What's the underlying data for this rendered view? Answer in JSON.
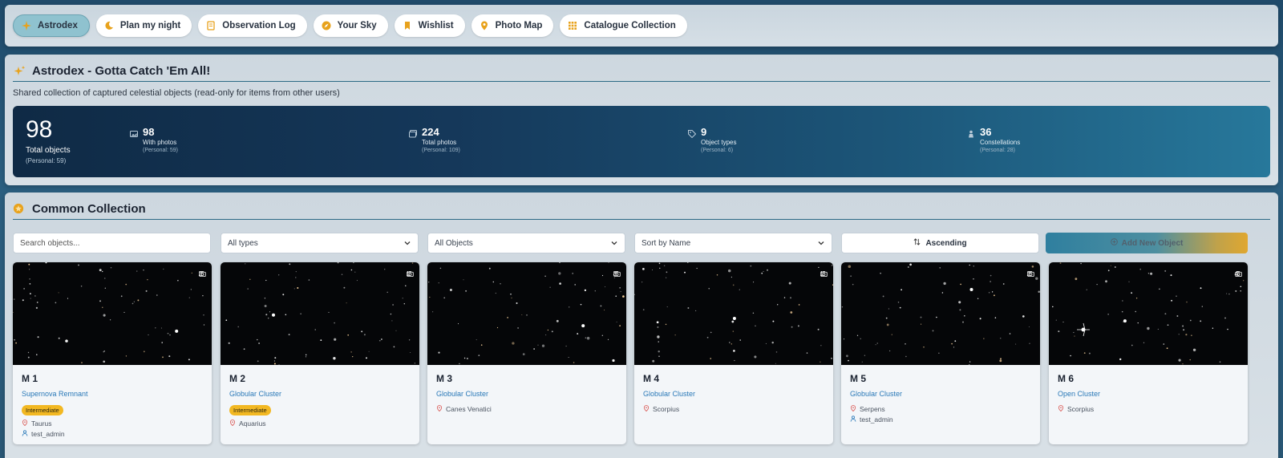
{
  "nav": {
    "items": [
      {
        "label": "Astrodex",
        "icon": "sparkle-icon",
        "active": true
      },
      {
        "label": "Plan my night",
        "icon": "moon-icon",
        "active": false
      },
      {
        "label": "Observation Log",
        "icon": "notebook-icon",
        "active": false
      },
      {
        "label": "Your Sky",
        "icon": "compass-icon",
        "active": false
      },
      {
        "label": "Wishlist",
        "icon": "bookmark-icon",
        "active": false
      },
      {
        "label": "Photo Map",
        "icon": "map-pin-icon",
        "active": false
      },
      {
        "label": "Catalogue Collection",
        "icon": "grid-icon",
        "active": false
      }
    ]
  },
  "header": {
    "title": "Astrodex - Gotta Catch 'Em All!",
    "subtitle": "Shared collection of captured celestial objects (read-only for items from other users)"
  },
  "stats": {
    "total": {
      "value": "98",
      "label": "Total objects",
      "sub": "(Personal: 59)"
    },
    "items": [
      {
        "value": "98",
        "label": "With photos",
        "sub": "(Personal: 59)",
        "icon": "image-icon"
      },
      {
        "value": "224",
        "label": "Total photos",
        "sub": "(Personal: 109)",
        "icon": "images-icon"
      },
      {
        "value": "9",
        "label": "Object types",
        "sub": "(Personal: 6)",
        "icon": "tag-icon"
      },
      {
        "value": "36",
        "label": "Constellations",
        "sub": "(Personal: 28)",
        "icon": "person-icon"
      }
    ]
  },
  "collection": {
    "title": "Common Collection",
    "search_placeholder": "Search objects...",
    "type_filter": "All types",
    "owner_filter": "All Objects",
    "sort": "Sort by Name",
    "order": "Ascending",
    "add_button": "Add New Object"
  },
  "cards": [
    {
      "name": "M 1",
      "type": "Supernova Remnant",
      "difficulty": "Intermediate",
      "constellation": "Taurus",
      "owner": "test_admin",
      "photos": "2"
    },
    {
      "name": "M 2",
      "type": "Globular Cluster",
      "difficulty": "Intermediate",
      "constellation": "Aquarius",
      "owner": "",
      "photos": "1"
    },
    {
      "name": "M 3",
      "type": "Globular Cluster",
      "difficulty": "",
      "constellation": "Canes Venatici",
      "owner": "",
      "photos": "3"
    },
    {
      "name": "M 4",
      "type": "Globular Cluster",
      "difficulty": "",
      "constellation": "Scorpius",
      "owner": "",
      "photos": "1"
    },
    {
      "name": "M 5",
      "type": "Globular Cluster",
      "difficulty": "",
      "constellation": "Serpens",
      "owner": "test_admin",
      "photos": "2"
    },
    {
      "name": "M 6",
      "type": "Open Cluster",
      "difficulty": "",
      "constellation": "Scorpius",
      "owner": "",
      "photos": "4"
    }
  ],
  "colors": {
    "accent": "#2d6a86",
    "badge": "#f2b822",
    "type_link": "#2a79b8",
    "icon_orange": "#e8a21c"
  }
}
